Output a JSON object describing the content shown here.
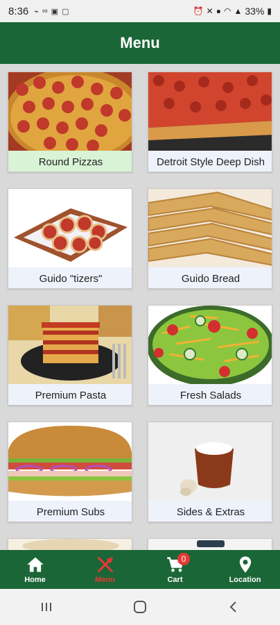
{
  "status_bar": {
    "time": "8:36",
    "battery": "33%"
  },
  "app_bar": {
    "title": "Menu"
  },
  "menu": {
    "items": [
      {
        "label": "Round Pizzas",
        "image": "round-pizza-image"
      },
      {
        "label": "Detroit Style Deep Dish",
        "image": "deep-dish-image"
      },
      {
        "label": "Guido \"tizers\"",
        "image": "pinwheel-appetizer-image"
      },
      {
        "label": "Guido Bread",
        "image": "bread-sticks-image"
      },
      {
        "label": "Premium Pasta",
        "image": "lasagna-image"
      },
      {
        "label": "Fresh Salads",
        "image": "salad-image"
      },
      {
        "label": "Premium Subs",
        "image": "sub-sandwich-image"
      },
      {
        "label": "Sides & Extras",
        "image": "dipping-sauce-image"
      }
    ]
  },
  "bottom_nav": {
    "home": "Home",
    "menu": "Menu",
    "cart": "Cart",
    "cart_count": "0",
    "location": "Location"
  },
  "colors": {
    "brand_green": "#1b6636",
    "accent_red": "#e53935",
    "selected_label": "#d8f3d6"
  }
}
